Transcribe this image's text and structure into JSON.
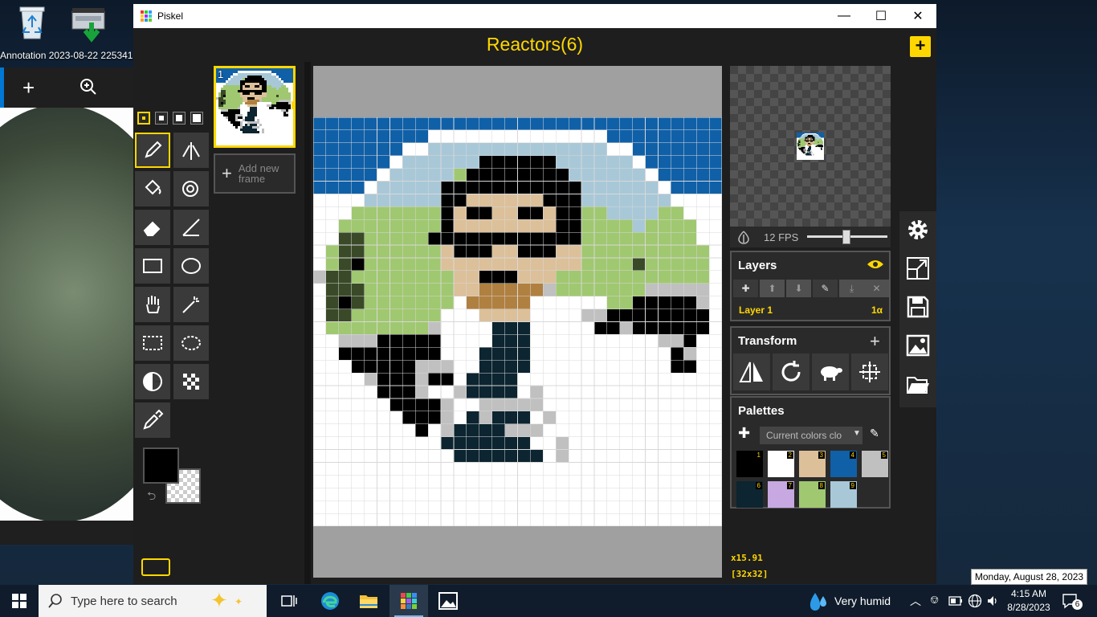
{
  "desktop": {
    "icons": [
      {
        "name": "Recycle Bin",
        "label": ""
      },
      {
        "name": "Scanner",
        "label": ""
      }
    ],
    "bg_window_label": "Annotation 2023-08-22 225341..."
  },
  "window": {
    "app_name": "Piskel",
    "controls": {
      "minimize": "—",
      "maximize": "☐",
      "close": "✕"
    }
  },
  "header": {
    "doc_title": "Reactors(6)",
    "new_button": "+"
  },
  "tools": {
    "pen_sizes": [
      1,
      2,
      3,
      4
    ],
    "selected_tool": "pen",
    "primary_color": "#000000",
    "secondary_color": "transparent"
  },
  "frames": {
    "items": [
      {
        "number": "1"
      }
    ],
    "add_frame_label": "Add new frame"
  },
  "preview": {
    "fps_label": "12 FPS",
    "fps_value": 12
  },
  "layers": {
    "title": "Layers",
    "items": [
      {
        "name": "Layer 1",
        "opacity": "1α"
      }
    ]
  },
  "transform": {
    "title": "Transform"
  },
  "palettes": {
    "title": "Palettes",
    "selected": "Current colors clo",
    "swatches": [
      {
        "n": "1",
        "color": "#000000"
      },
      {
        "n": "2",
        "color": "#ffffff"
      },
      {
        "n": "3",
        "color": "#dcc09a"
      },
      {
        "n": "4",
        "color": "#1060a8"
      },
      {
        "n": "5",
        "color": "#c0c0c0"
      },
      {
        "n": "6",
        "color": "#0c2530"
      },
      {
        "n": "7",
        "color": "#c8a8e0"
      },
      {
        "n": "8",
        "color": "#a0c870"
      },
      {
        "n": "9",
        "color": "#a8c8d8"
      }
    ]
  },
  "status": {
    "zoom": "x15.91",
    "size": "[32x32]"
  },
  "taskbar": {
    "search_placeholder": "Type here to search",
    "weather": "Very humid",
    "time": "4:15 AM",
    "date": "8/28/2023",
    "notifications": "6",
    "tooltip": "Monday, August 28, 2023"
  },
  "colors": {
    "accent": "#ffd700",
    "panel_bg": "#2a2a2a",
    "window_bg": "#1e1e1e"
  }
}
